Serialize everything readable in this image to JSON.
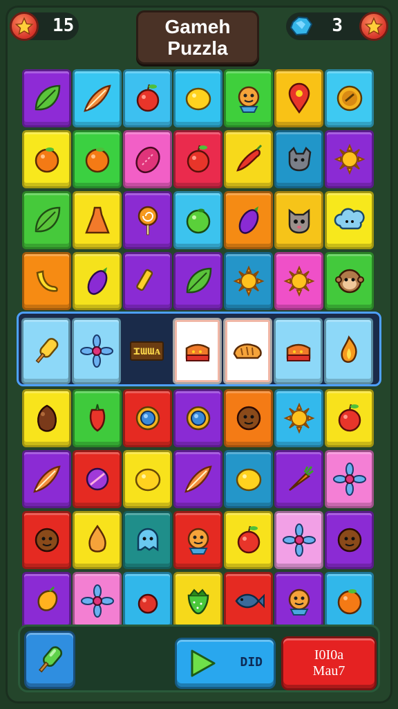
{
  "hud": {
    "score_value": "15",
    "score_icon": "star-icon",
    "gems_value": "3",
    "gems_icon": "gem-icon",
    "bonus_icon": "star-icon"
  },
  "title": {
    "line1": "Gameh",
    "line2": "Puzzla"
  },
  "board": {
    "rows": [
      [
        "leaf-icon",
        "feather-icon",
        "apple-icon",
        "lemon-icon",
        "creature-icon",
        "map-pin-icon",
        "coin-icon"
      ],
      [
        "orange-icon",
        "orange-icon",
        "bean-icon",
        "apple-icon",
        "chili-icon",
        "dog-icon",
        "sun-icon"
      ],
      [
        "leaf-icon",
        "dress-icon",
        "lollipop-icon",
        "lime-icon",
        "eggplant-icon",
        "cat-icon",
        "cloud-icon"
      ],
      [
        "banana-icon",
        "eggplant-icon",
        "fries-icon",
        "leaf-icon",
        "sun-icon",
        "sun-icon",
        "monkey-icon"
      ],
      [
        "popsicle-icon",
        "flower-icon",
        "sign-icon",
        "cake-icon",
        "bread-icon",
        "cake-icon",
        "flame-icon"
      ],
      [
        "chestnut-icon",
        "pepper-icon",
        "ring-icon",
        "ring-icon",
        "coconut-icon",
        "sun-icon",
        "apple-icon"
      ],
      [
        "feather-icon",
        "orb-icon",
        "lemon-icon",
        "feather-icon",
        "lemon-icon",
        "carrot-icon",
        "flower-icon"
      ],
      [
        "coconut-icon",
        "drop-icon",
        "ghost-icon",
        "creature-icon",
        "apple-icon",
        "flower-icon",
        "coconut-icon"
      ],
      [
        "mango-icon",
        "flower-icon",
        "cherry-icon",
        "strawberry-icon",
        "fish-icon",
        "creature-icon",
        "orange-icon"
      ]
    ],
    "colors": [
      [
        "#8e2bd6",
        "#38c7f2",
        "#3dc0f0",
        "#33c3f0",
        "#3fcf3c",
        "#f9c216",
        "#3ec9f2"
      ],
      [
        "#f8e81d",
        "#3bd041",
        "#f25fc6",
        "#ea2b4d",
        "#f7d91b",
        "#2196c9",
        "#8b2bd4"
      ],
      [
        "#46c93b",
        "#f9e21c",
        "#8b2bd2",
        "#3cc3ee",
        "#f58b14",
        "#f6c419",
        "#f7e81c"
      ],
      [
        "#f68b13",
        "#f5e21c",
        "#8a2bd4",
        "#8a2bd4",
        "#2495c9",
        "#ef50c8",
        "#43c93c"
      ],
      [
        "#8dd8f8",
        "#8dd8f8",
        "transparent",
        "#ffffff",
        "#ffffff",
        "#8dd8f8",
        "#8dd8f8"
      ],
      [
        "#f8e41c",
        "#3fca3c",
        "#e52a22",
        "#8a2bd4",
        "#f47b15",
        "#33b9ec",
        "#f8e21c"
      ],
      [
        "#8b2bd4",
        "#e52a22",
        "#f8e21c",
        "#8b2bd4",
        "#2496c9",
        "#8b2bd4",
        "#f47fd5"
      ],
      [
        "#e52a22",
        "#f8e21c",
        "#1f8e8a",
        "#e52a22",
        "#f8e21c",
        "#f2a0e6",
        "#8b2bd4"
      ],
      [
        "#8b2bd4",
        "#f37fd2",
        "#31b7ea",
        "#f6d91b",
        "#e52a22",
        "#8b2bd4",
        "#31b7ea"
      ]
    ],
    "special_sign_text": "ɪɯɯᴀ"
  },
  "bottom": {
    "powerup_icon": "popsicle-icon",
    "play_icon": "play-icon",
    "next_label": "DID",
    "menu_line1": "I0I0a",
    "menu_line2": "Mau7"
  }
}
